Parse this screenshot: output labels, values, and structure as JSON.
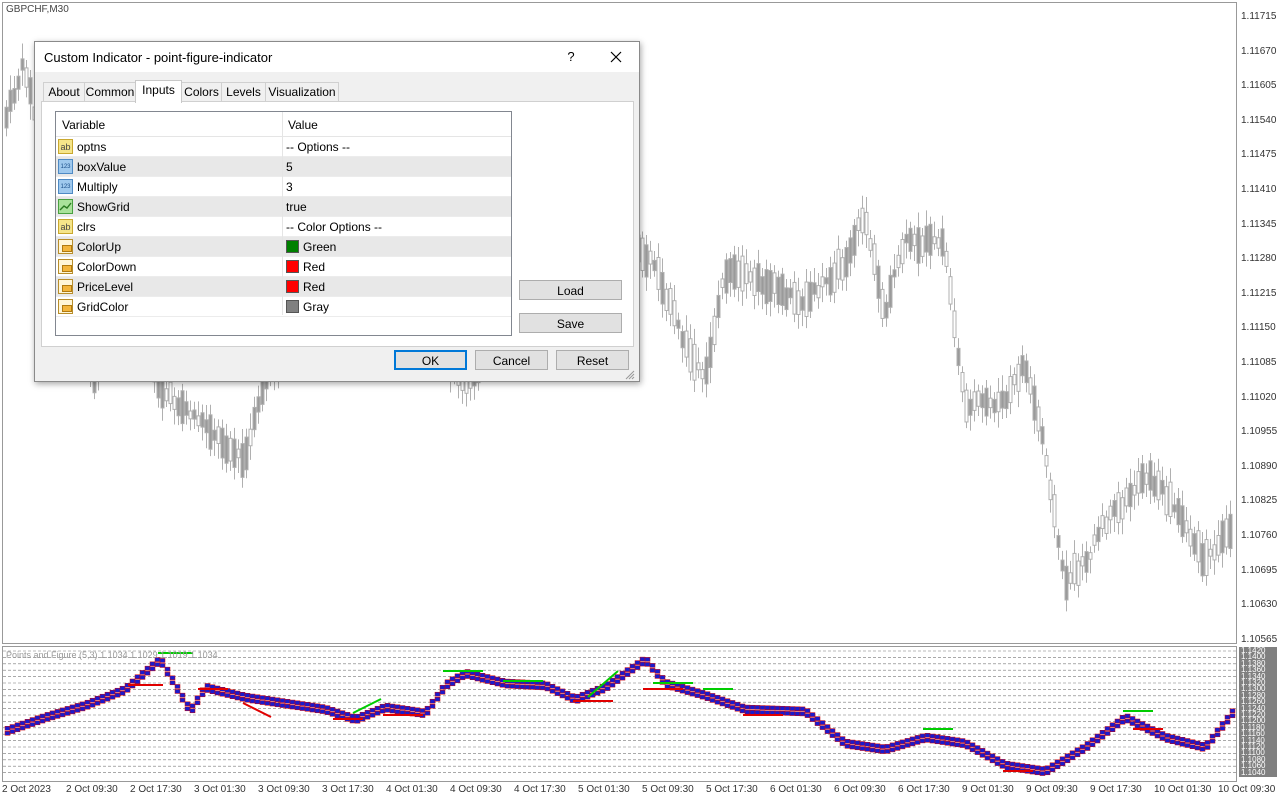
{
  "chart": {
    "symbol": "GBPCHF,M30",
    "indicator_label": "Points and Figure (5,3)",
    "indicator_values": "1.1034  1.1029  1.1019  1.1034",
    "price_labels": [
      "1.11715",
      "1.11670",
      "1.11605",
      "1.11540",
      "1.11475",
      "1.11410",
      "1.11345",
      "1.11280",
      "1.11215",
      "1.11150",
      "1.11085",
      "1.11020",
      "1.10955",
      "1.10890",
      "1.10825",
      "1.10760",
      "1.10695",
      "1.10630",
      "1.10565"
    ],
    "sub_price_labels": [
      "1.1420",
      "1.1400",
      "1.1380",
      "1.1360",
      "1.1340",
      "1.1320",
      "1.1300",
      "1.1280",
      "1.1260",
      "1.1240",
      "1.1220",
      "1.1200",
      "1.1180",
      "1.1160",
      "1.1140",
      "1.1120",
      "1.1100",
      "1.1080",
      "1.1060",
      "1.1040"
    ],
    "time_labels": [
      "2 Oct 2023",
      "2 Oct 09:30",
      "2 Oct 17:30",
      "3 Oct 01:30",
      "3 Oct 09:30",
      "3 Oct 17:30",
      "4 Oct 01:30",
      "4 Oct 09:30",
      "4 Oct 17:30",
      "5 Oct 01:30",
      "5 Oct 09:30",
      "5 Oct 17:30",
      "6 Oct 01:30",
      "6 Oct 09:30",
      "6 Oct 17:30",
      "9 Oct 01:30",
      "9 Oct 09:30",
      "9 Oct 17:30",
      "10 Oct 01:30",
      "10 Oct 09:30"
    ],
    "colors": {
      "candle": "#b0b0b0",
      "box_fill": "#1a1acd",
      "box_border": "#d00000",
      "up_line": "#00cc00",
      "down_line": "#e00000"
    }
  },
  "dialog": {
    "title": "Custom Indicator - point-figure-indicator",
    "help_label": "?",
    "close_icon": "close-icon",
    "tabs": [
      {
        "label": "About",
        "active": false
      },
      {
        "label": "Common",
        "active": false
      },
      {
        "label": "Inputs",
        "active": true
      },
      {
        "label": "Colors",
        "active": false
      },
      {
        "label": "Levels",
        "active": false
      },
      {
        "label": "Visualization",
        "active": false
      }
    ],
    "grid": {
      "header_variable": "Variable",
      "header_value": "Value",
      "rows": [
        {
          "type": "str",
          "icon_text": "ab",
          "variable": "optns",
          "value": "-- Options --"
        },
        {
          "type": "num",
          "icon_text": "123",
          "variable": "boxValue",
          "value": "5"
        },
        {
          "type": "num",
          "icon_text": "123",
          "variable": "Multiply",
          "value": "3"
        },
        {
          "type": "bool",
          "icon_text": "",
          "variable": "ShowGrid",
          "value": "true"
        },
        {
          "type": "str",
          "icon_text": "ab",
          "variable": "clrs",
          "value": "-- Color Options --"
        },
        {
          "type": "col",
          "icon_text": "",
          "variable": "ColorUp",
          "value": "Green",
          "swatch": "#008000"
        },
        {
          "type": "col",
          "icon_text": "",
          "variable": "ColorDown",
          "value": "Red",
          "swatch": "#ff0000"
        },
        {
          "type": "col",
          "icon_text": "",
          "variable": "PriceLevel",
          "value": "Red",
          "swatch": "#ff0000"
        },
        {
          "type": "col",
          "icon_text": "",
          "variable": "GridColor",
          "value": "Gray",
          "swatch": "#808080"
        }
      ]
    },
    "buttons": {
      "load": "Load",
      "save": "Save",
      "ok": "OK",
      "cancel": "Cancel",
      "reset": "Reset"
    }
  }
}
